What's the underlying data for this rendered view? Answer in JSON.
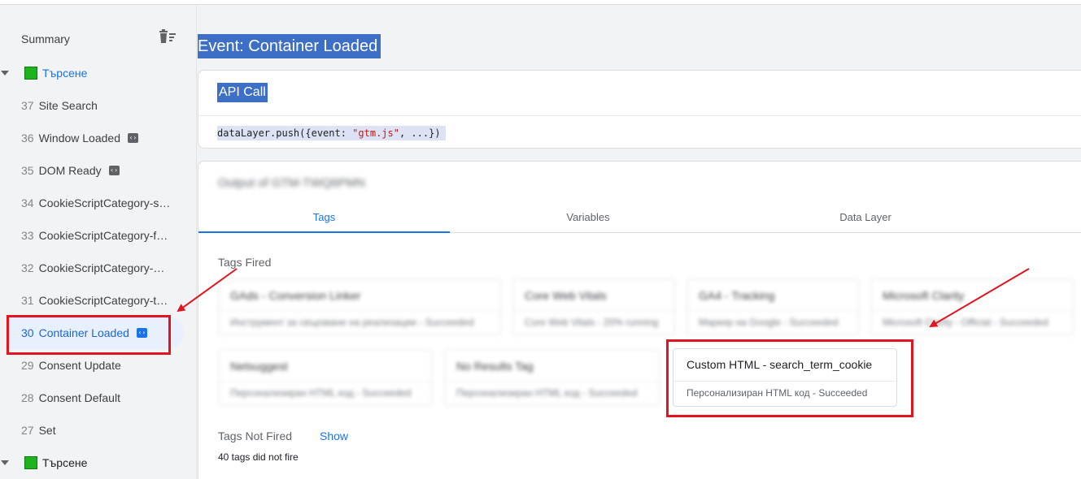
{
  "sidebar": {
    "summary_label": "Summary",
    "groups": [
      {
        "label": "Търсене"
      },
      {
        "label": "Търсене"
      }
    ],
    "events": [
      {
        "num": "37",
        "label": "Site Search",
        "has_code_icon": false
      },
      {
        "num": "36",
        "label": "Window Loaded",
        "has_code_icon": true
      },
      {
        "num": "35",
        "label": "DOM Ready",
        "has_code_icon": true
      },
      {
        "num": "34",
        "label": "CookieScriptCategory-s…",
        "has_code_icon": false
      },
      {
        "num": "33",
        "label": "CookieScriptCategory-f…",
        "has_code_icon": false
      },
      {
        "num": "32",
        "label": "CookieScriptCategory-…",
        "has_code_icon": false
      },
      {
        "num": "31",
        "label": "CookieScriptCategory-t…",
        "has_code_icon": false
      },
      {
        "num": "30",
        "label": "Container Loaded",
        "has_code_icon": true,
        "selected": true
      },
      {
        "num": "29",
        "label": "Consent Update",
        "has_code_icon": false
      },
      {
        "num": "28",
        "label": "Consent Default",
        "has_code_icon": false
      },
      {
        "num": "27",
        "label": "Set",
        "has_code_icon": false
      }
    ]
  },
  "main": {
    "title": "Event: Container Loaded",
    "api_card": {
      "title": "API Call",
      "code_prefix": "dataLayer.push({event: ",
      "code_string": "\"gtm.js\"",
      "code_suffix": ", ...})"
    },
    "output": {
      "title": "Output of GTM-TWQ6PMN",
      "tabs": [
        "Tags",
        "Variables",
        "Data Layer"
      ],
      "active_tab": "Tags",
      "tags_fired_label": "Tags Fired",
      "fired_tags": [
        {
          "name": "GAds - Conversion Linker",
          "status": "Инструмент за свързване на реализации - Succeeded"
        },
        {
          "name": "Core Web Vitals",
          "status": "Core Web Vitals - 20% running"
        },
        {
          "name": "GA4 - Tracking",
          "status": "Маркер на Google - Succeeded"
        },
        {
          "name": "Microsoft Clarity",
          "status": "Microsoft Clarity - Official - Succeeded"
        },
        {
          "name": "Netsuggest",
          "status": "Персонализиран HTML код - Succeeded"
        },
        {
          "name": "No Results Tag",
          "status": "Персонализиран HTML код - Succeeded"
        }
      ],
      "highlighted_tag": {
        "name": "Custom HTML - search_term_cookie",
        "status": "Персонализиран HTML код - Succeeded"
      },
      "tags_not_fired_label": "Tags Not Fired",
      "show_label": "Show",
      "not_fired_count": "40 tags did not fire"
    }
  },
  "colors": {
    "accent": "#1a73e8",
    "selection_highlight": "#3e6fc7",
    "annotation_red": "#e0151f",
    "group_square": "#1db31d"
  }
}
